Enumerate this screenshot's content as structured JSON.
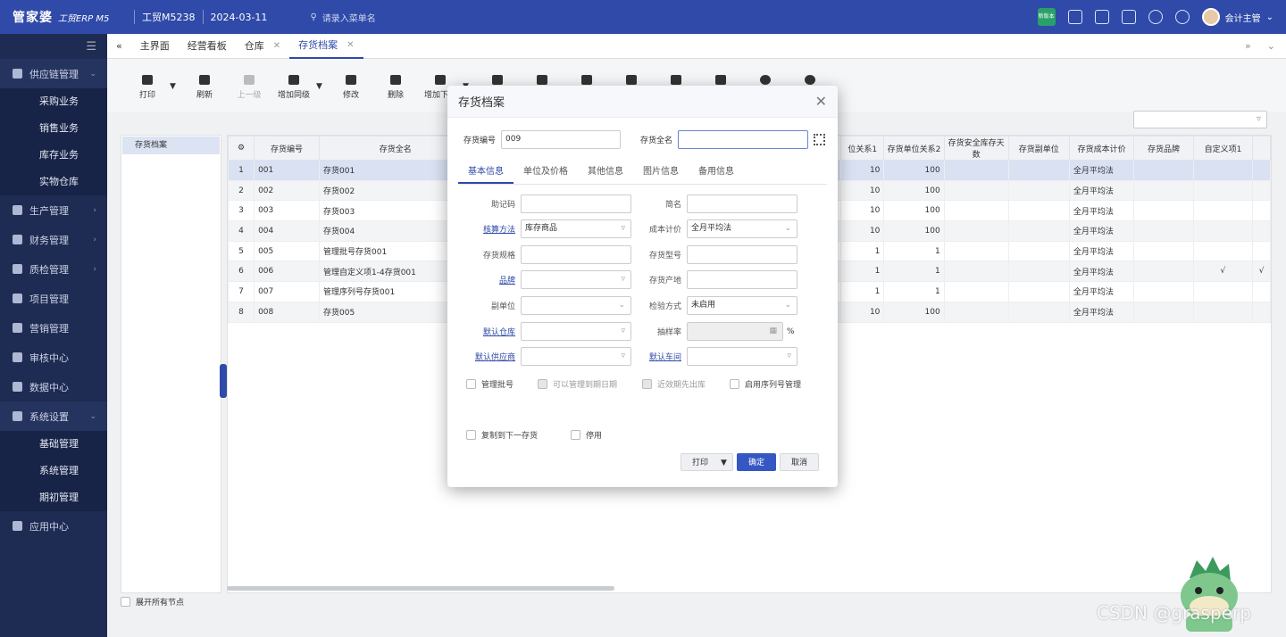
{
  "brand": {
    "logo": "管家婆",
    "product": "工贸ERP M5",
    "version": "工贸M5238",
    "date": "2024-03-11",
    "search_placeholder": "请录入菜单名",
    "user": "会计主管",
    "badge": "新版本"
  },
  "sidebar": {
    "items": [
      {
        "label": "供应链管理",
        "open": true,
        "children": [
          "采购业务",
          "销售业务",
          "库存业务",
          "实物仓库"
        ]
      },
      {
        "label": "生产管理"
      },
      {
        "label": "财务管理"
      },
      {
        "label": "质检管理"
      },
      {
        "label": "项目管理"
      },
      {
        "label": "营销管理"
      },
      {
        "label": "审核中心"
      },
      {
        "label": "数据中心"
      },
      {
        "label": "系统设置",
        "open": true,
        "children": [
          "基础管理",
          "系统管理",
          "期初管理"
        ]
      },
      {
        "label": "应用中心"
      }
    ]
  },
  "tabs": [
    "主界面",
    "经营看板",
    "仓库",
    "存货档案"
  ],
  "toolbar": [
    "打印",
    "刷新",
    "上一级",
    "增加同级",
    "修改",
    "删除",
    "增加下级"
  ],
  "tree": {
    "root": "存货档案",
    "expand_all": "展开所有节点"
  },
  "grid": {
    "left_columns": [
      "存货编号",
      "存货全名"
    ],
    "right_columns": [
      "位关系1",
      "存货单位关系2",
      "存货安全库存天数",
      "存货副单位",
      "存货成本计价",
      "存货品牌",
      "自定义项1"
    ],
    "rows": [
      {
        "n": "1",
        "code": "001",
        "name": "存货001",
        "r1": "10",
        "r2": "100",
        "cost": "全月平均法",
        "c1": "",
        "c2": ""
      },
      {
        "n": "2",
        "code": "002",
        "name": "存货002",
        "r1": "10",
        "r2": "100",
        "cost": "全月平均法",
        "c1": "",
        "c2": ""
      },
      {
        "n": "3",
        "code": "003",
        "name": "存货003",
        "r1": "10",
        "r2": "100",
        "cost": "全月平均法",
        "c1": "",
        "c2": ""
      },
      {
        "n": "4",
        "code": "004",
        "name": "存货004",
        "r1": "10",
        "r2": "100",
        "cost": "全月平均法",
        "c1": "",
        "c2": ""
      },
      {
        "n": "5",
        "code": "005",
        "name": "管理批号存货001",
        "r1": "1",
        "r2": "1",
        "cost": "全月平均法",
        "c1": "",
        "c2": ""
      },
      {
        "n": "6",
        "code": "006",
        "name": "管理自定义项1-4存货001",
        "r1": "1",
        "r2": "1",
        "cost": "全月平均法",
        "c1": "√",
        "c2": "√"
      },
      {
        "n": "7",
        "code": "007",
        "name": "管理序列号存货001",
        "r1": "1",
        "r2": "1",
        "cost": "全月平均法",
        "c1": "",
        "c2": ""
      },
      {
        "n": "8",
        "code": "008",
        "name": "存货005",
        "r1": "10",
        "r2": "100",
        "cost": "全月平均法",
        "c1": "",
        "c2": ""
      }
    ]
  },
  "dialog": {
    "title": "存货档案",
    "code_label": "存货编号",
    "code_value": "009",
    "name_label": "存货全名",
    "name_value": "",
    "tabs": [
      "基本信息",
      "单位及价格",
      "其他信息",
      "图片信息",
      "备用信息"
    ],
    "f_mnemonic": "助记码",
    "f_short": "简名",
    "f_settle": "核算方法",
    "f_settle_value": "库存商品",
    "f_cost": "成本计价",
    "f_cost_value": "全月平均法",
    "f_spec": "存货规格",
    "f_model": "存货型号",
    "f_brand": "品牌",
    "f_origin": "存货产地",
    "f_subunit": "副单位",
    "f_inspect": "检验方式",
    "f_inspect_value": "未启用",
    "f_wh": "默认仓库",
    "f_sample": "抽样率",
    "f_percent": "%",
    "f_supplier": "默认供应商",
    "f_workshop": "默认车间",
    "chk_batch": "管理批号",
    "chk_expiry": "可以管理到期日期",
    "chk_fefo": "近效期先出库",
    "chk_serial": "启用序列号管理",
    "chk_copy": "复制到下一存货",
    "chk_disable": "停用",
    "btn_print": "打印",
    "btn_ok": "确定",
    "btn_cancel": "取消"
  },
  "watermark": "CSDN @grasperp"
}
